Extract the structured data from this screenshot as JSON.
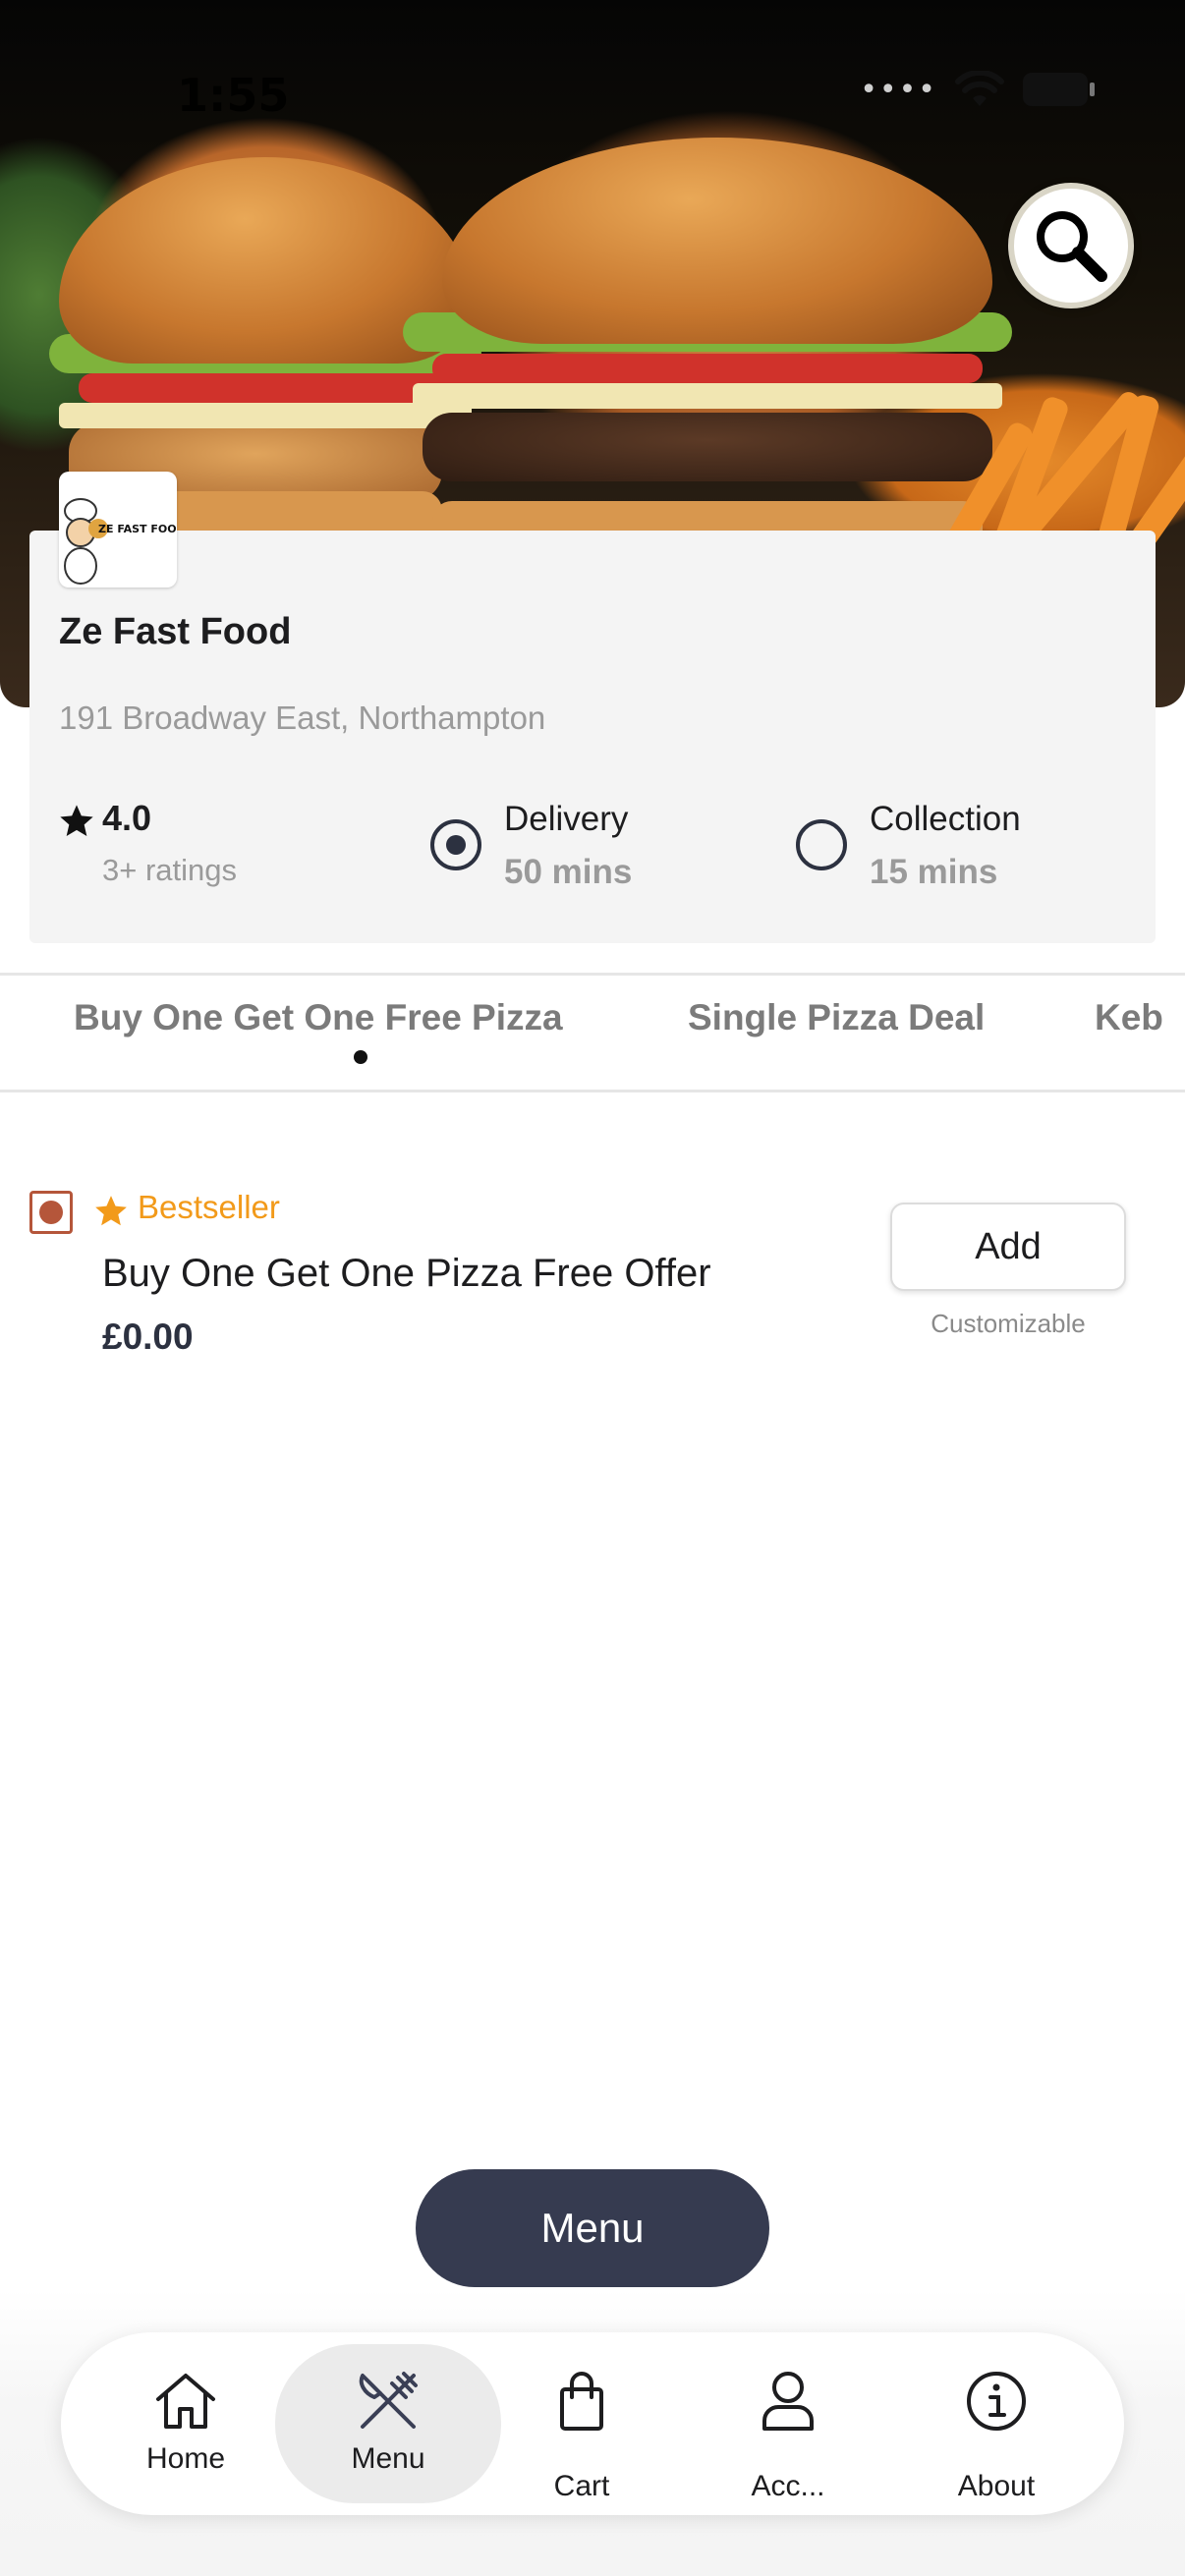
{
  "status_bar": {
    "time": "1:55"
  },
  "store": {
    "name": "Ze Fast Food",
    "address": "191 Broadway East, Northampton",
    "rating": "4.0",
    "rating_count": "3+ ratings",
    "logo_text": "ZE FAST FOOD"
  },
  "order_options": [
    {
      "title": "Delivery",
      "time": "50 mins",
      "selected": true
    },
    {
      "title": "Collection",
      "time": "15 mins",
      "selected": false
    }
  ],
  "category_tabs": [
    {
      "label": "Buy One Get One Free Pizza",
      "active": true
    },
    {
      "label": "Single Pizza Deal",
      "active": false
    },
    {
      "label": "Keb",
      "active": false
    }
  ],
  "product": {
    "badge": "Bestseller",
    "name": "Buy One Get One Pizza Free Offer",
    "price": "£0.00",
    "add_label": "Add",
    "note": "Customizable"
  },
  "menu_button": {
    "label": "Menu"
  },
  "bottom_nav": [
    {
      "label": "Home",
      "icon": "home-icon",
      "active": false
    },
    {
      "label": "Menu",
      "icon": "fork-knife-icon",
      "active": true
    },
    {
      "label": "Cart",
      "icon": "shopping-bag-icon",
      "active": false
    },
    {
      "label": "Acc...",
      "icon": "user-icon",
      "active": false
    },
    {
      "label": "About",
      "icon": "info-icon",
      "active": false
    }
  ],
  "colors": {
    "accent_dark": "#363b50",
    "bestseller": "#f29a1a",
    "veg_mark": "#b5563a"
  }
}
